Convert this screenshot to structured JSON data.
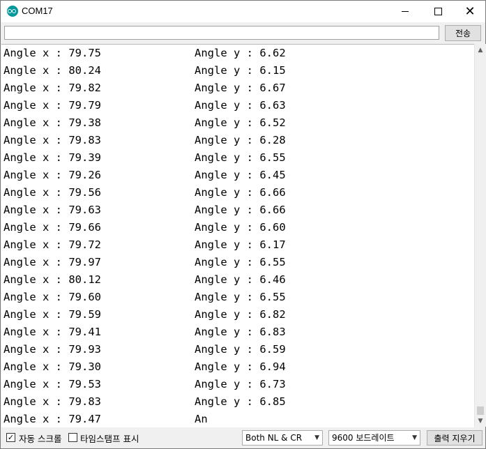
{
  "window": {
    "title": "COM17"
  },
  "input_row": {
    "value": "",
    "send_label": "전송"
  },
  "output_lines": [
    {
      "x": "Angle x : 79.75",
      "y": "Angle y : 6.62"
    },
    {
      "x": "Angle x : 80.24",
      "y": "Angle y : 6.15"
    },
    {
      "x": "Angle x : 79.82",
      "y": "Angle y : 6.67"
    },
    {
      "x": "Angle x : 79.79",
      "y": "Angle y : 6.63"
    },
    {
      "x": "Angle x : 79.38",
      "y": "Angle y : 6.52"
    },
    {
      "x": "Angle x : 79.83",
      "y": "Angle y : 6.28"
    },
    {
      "x": "Angle x : 79.39",
      "y": "Angle y : 6.55"
    },
    {
      "x": "Angle x : 79.26",
      "y": "Angle y : 6.45"
    },
    {
      "x": "Angle x : 79.56",
      "y": "Angle y : 6.66"
    },
    {
      "x": "Angle x : 79.63",
      "y": "Angle y : 6.66"
    },
    {
      "x": "Angle x : 79.66",
      "y": "Angle y : 6.60"
    },
    {
      "x": "Angle x : 79.72",
      "y": "Angle y : 6.17"
    },
    {
      "x": "Angle x : 79.97",
      "y": "Angle y : 6.55"
    },
    {
      "x": "Angle x : 80.12",
      "y": "Angle y : 6.46"
    },
    {
      "x": "Angle x : 79.60",
      "y": "Angle y : 6.55"
    },
    {
      "x": "Angle x : 79.59",
      "y": "Angle y : 6.82"
    },
    {
      "x": "Angle x : 79.41",
      "y": "Angle y : 6.83"
    },
    {
      "x": "Angle x : 79.93",
      "y": "Angle y : 6.59"
    },
    {
      "x": "Angle x : 79.30",
      "y": "Angle y : 6.94"
    },
    {
      "x": "Angle x : 79.53",
      "y": "Angle y : 6.73"
    },
    {
      "x": "Angle x : 79.83",
      "y": "Angle y : 6.85"
    },
    {
      "x": "Angle x : 79.47",
      "y": "An"
    }
  ],
  "bottom_bar": {
    "autoscroll": {
      "label": "자동 스크롤",
      "checked": true
    },
    "timestamp": {
      "label": "타임스탬프 표시",
      "checked": false
    },
    "line_ending": "Both NL & CR",
    "baud_rate": "9600 보드레이트",
    "clear_label": "출력 지우기"
  },
  "icons": {
    "app": "arduino-icon",
    "minimize": "minimize-icon",
    "maximize": "maximize-icon",
    "close": "close-icon",
    "scroll_up": "chevron-up-icon",
    "scroll_down": "chevron-down-icon"
  },
  "colors": {
    "accent": "#00979c"
  }
}
